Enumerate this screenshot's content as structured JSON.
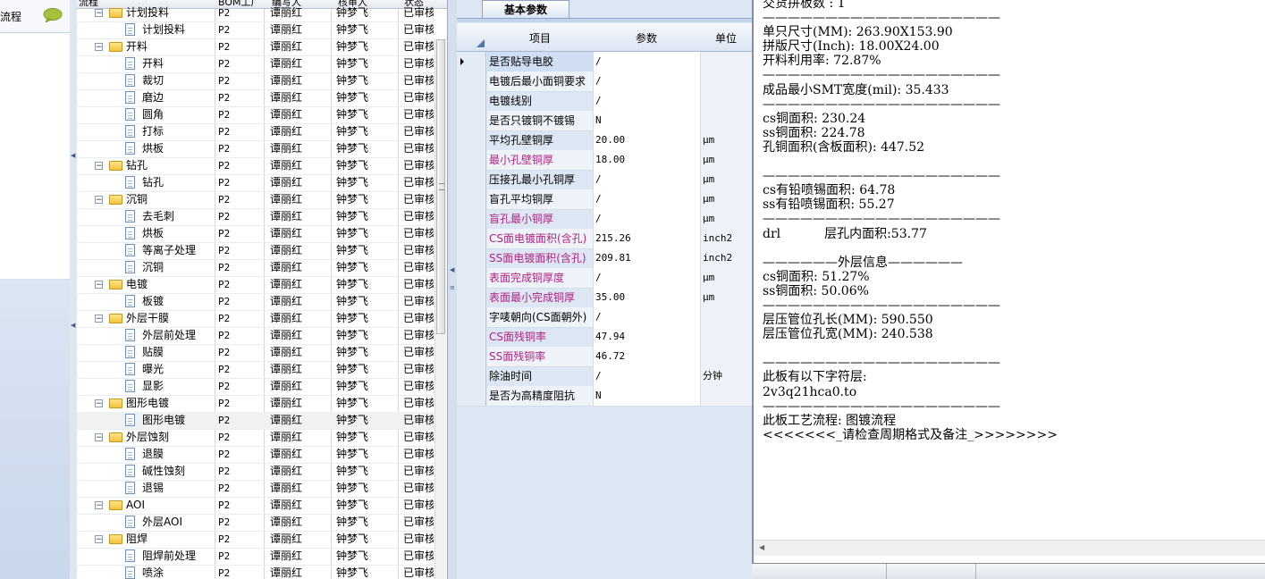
{
  "left_panel": {
    "label": "流程",
    "chat_icon": "chat-bubble-icon"
  },
  "tree": {
    "headers": {
      "flow": "流程",
      "bom": "BOM工厂",
      "author": "编写人",
      "reviewer": "核审人",
      "status": "状态"
    },
    "rows": [
      {
        "name": "计划投料",
        "level": 0,
        "type": "folder",
        "bom": "P2",
        "author": "谭丽红",
        "reviewer": "钟梦飞",
        "status": "已审核"
      },
      {
        "name": "计划投料",
        "level": 1,
        "type": "doc",
        "bom": "P2",
        "author": "谭丽红",
        "reviewer": "钟梦飞",
        "status": "已审核"
      },
      {
        "name": "开料",
        "level": 0,
        "type": "folder",
        "bom": "P2",
        "author": "谭丽红",
        "reviewer": "钟梦飞",
        "status": "已审核"
      },
      {
        "name": "开料",
        "level": 1,
        "type": "doc",
        "bom": "P2",
        "author": "谭丽红",
        "reviewer": "钟梦飞",
        "status": "已审核"
      },
      {
        "name": "裁切",
        "level": 1,
        "type": "doc",
        "bom": "P2",
        "author": "谭丽红",
        "reviewer": "钟梦飞",
        "status": "已审核"
      },
      {
        "name": "磨边",
        "level": 1,
        "type": "doc",
        "bom": "P2",
        "author": "谭丽红",
        "reviewer": "钟梦飞",
        "status": "已审核"
      },
      {
        "name": "圆角",
        "level": 1,
        "type": "doc",
        "bom": "P2",
        "author": "谭丽红",
        "reviewer": "钟梦飞",
        "status": "已审核"
      },
      {
        "name": "打标",
        "level": 1,
        "type": "doc",
        "bom": "P2",
        "author": "谭丽红",
        "reviewer": "钟梦飞",
        "status": "已审核"
      },
      {
        "name": "烘板",
        "level": 1,
        "type": "doc",
        "bom": "P2",
        "author": "谭丽红",
        "reviewer": "钟梦飞",
        "status": "已审核"
      },
      {
        "name": "钻孔",
        "level": 0,
        "type": "folder",
        "bom": "P2",
        "author": "谭丽红",
        "reviewer": "钟梦飞",
        "status": "已审核"
      },
      {
        "name": "钻孔",
        "level": 1,
        "type": "doc",
        "bom": "P2",
        "author": "谭丽红",
        "reviewer": "钟梦飞",
        "status": "已审核"
      },
      {
        "name": "沉铜",
        "level": 0,
        "type": "folder",
        "bom": "P2",
        "author": "谭丽红",
        "reviewer": "钟梦飞",
        "status": "已审核"
      },
      {
        "name": "去毛刺",
        "level": 1,
        "type": "doc",
        "bom": "P2",
        "author": "谭丽红",
        "reviewer": "钟梦飞",
        "status": "已审核"
      },
      {
        "name": "烘板",
        "level": 1,
        "type": "doc",
        "bom": "P2",
        "author": "谭丽红",
        "reviewer": "钟梦飞",
        "status": "已审核"
      },
      {
        "name": "等离子处理",
        "level": 1,
        "type": "doc",
        "bom": "P2",
        "author": "谭丽红",
        "reviewer": "钟梦飞",
        "status": "已审核"
      },
      {
        "name": "沉铜",
        "level": 1,
        "type": "doc",
        "bom": "P2",
        "author": "谭丽红",
        "reviewer": "钟梦飞",
        "status": "已审核"
      },
      {
        "name": "电镀",
        "level": 0,
        "type": "folder",
        "bom": "P2",
        "author": "谭丽红",
        "reviewer": "钟梦飞",
        "status": "已审核"
      },
      {
        "name": "板镀",
        "level": 1,
        "type": "doc",
        "bom": "P2",
        "author": "谭丽红",
        "reviewer": "钟梦飞",
        "status": "已审核"
      },
      {
        "name": "外层干膜",
        "level": 0,
        "type": "folder",
        "bom": "P2",
        "author": "谭丽红",
        "reviewer": "钟梦飞",
        "status": "已审核"
      },
      {
        "name": "外层前处理",
        "level": 1,
        "type": "doc",
        "bom": "P2",
        "author": "谭丽红",
        "reviewer": "钟梦飞",
        "status": "已审核"
      },
      {
        "name": "贴膜",
        "level": 1,
        "type": "doc",
        "bom": "P2",
        "author": "谭丽红",
        "reviewer": "钟梦飞",
        "status": "已审核"
      },
      {
        "name": "曝光",
        "level": 1,
        "type": "doc",
        "bom": "P2",
        "author": "谭丽红",
        "reviewer": "钟梦飞",
        "status": "已审核"
      },
      {
        "name": "显影",
        "level": 1,
        "type": "doc",
        "bom": "P2",
        "author": "谭丽红",
        "reviewer": "钟梦飞",
        "status": "已审核"
      },
      {
        "name": "图形电镀",
        "level": 0,
        "type": "folder",
        "bom": "P2",
        "author": "谭丽红",
        "reviewer": "钟梦飞",
        "status": "已审核"
      },
      {
        "name": "图形电镀",
        "level": 1,
        "type": "doc",
        "bom": "P2",
        "author": "谭丽红",
        "reviewer": "钟梦飞",
        "status": "已审核",
        "selected": true
      },
      {
        "name": "外层蚀刻",
        "level": 0,
        "type": "folder",
        "bom": "P2",
        "author": "谭丽红",
        "reviewer": "钟梦飞",
        "status": "已审核"
      },
      {
        "name": "退膜",
        "level": 1,
        "type": "doc",
        "bom": "P2",
        "author": "谭丽红",
        "reviewer": "钟梦飞",
        "status": "已审核"
      },
      {
        "name": "碱性蚀刻",
        "level": 1,
        "type": "doc",
        "bom": "P2",
        "author": "谭丽红",
        "reviewer": "钟梦飞",
        "status": "已审核"
      },
      {
        "name": "退锡",
        "level": 1,
        "type": "doc",
        "bom": "P2",
        "author": "谭丽红",
        "reviewer": "钟梦飞",
        "status": "已审核"
      },
      {
        "name": "AOI",
        "level": 0,
        "type": "folder",
        "bom": "P2",
        "author": "谭丽红",
        "reviewer": "钟梦飞",
        "status": "已审核"
      },
      {
        "name": "外层AOI",
        "level": 1,
        "type": "doc",
        "bom": "P2",
        "author": "谭丽红",
        "reviewer": "钟梦飞",
        "status": "已审核"
      },
      {
        "name": "阻焊",
        "level": 0,
        "type": "folder",
        "bom": "P2",
        "author": "谭丽红",
        "reviewer": "钟梦飞",
        "status": "已审核"
      },
      {
        "name": "阻焊前处理",
        "level": 1,
        "type": "doc",
        "bom": "P2",
        "author": "谭丽红",
        "reviewer": "钟梦飞",
        "status": "已审核"
      },
      {
        "name": "喷涂",
        "level": 1,
        "type": "doc",
        "bom": "P2",
        "author": "谭丽红",
        "reviewer": "钟梦飞",
        "status": "已审核"
      }
    ]
  },
  "params": {
    "tab_label": "基本参数",
    "headers": {
      "item": "项目",
      "param": "参数",
      "unit": "单位"
    },
    "rows": [
      {
        "item": "是否贴导电胶",
        "value": "/",
        "unit": "",
        "pink": false,
        "current": true
      },
      {
        "item": "电镀后最小面铜要求",
        "value": "/",
        "unit": "",
        "pink": false
      },
      {
        "item": "电镀线别",
        "value": "/",
        "unit": "",
        "pink": false
      },
      {
        "item": "是否只镀铜不镀锡",
        "value": "N",
        "unit": "",
        "pink": false
      },
      {
        "item": "平均孔壁铜厚",
        "value": "20.00",
        "unit": "μm",
        "pink": false
      },
      {
        "item": "最小孔壁铜厚",
        "value": "18.00",
        "unit": "μm",
        "pink": true
      },
      {
        "item": "压接孔最小孔铜厚",
        "value": "/",
        "unit": "μm",
        "pink": false
      },
      {
        "item": "盲孔平均铜厚",
        "value": "/",
        "unit": "μm",
        "pink": false
      },
      {
        "item": "盲孔最小铜厚",
        "value": "/",
        "unit": "μm",
        "pink": true
      },
      {
        "item": "CS面电镀面积(含孔)",
        "value": "215.26",
        "unit": "inch2",
        "pink": true
      },
      {
        "item": "SS面电镀面积(含孔)",
        "value": "209.81",
        "unit": "inch2",
        "pink": true
      },
      {
        "item": "表面完成铜厚度",
        "value": "/",
        "unit": "μm",
        "pink": true
      },
      {
        "item": "表面最小完成铜厚",
        "value": "35.00",
        "unit": "μm",
        "pink": true
      },
      {
        "item": "字唛朝向(CS面朝外)",
        "value": "/",
        "unit": "",
        "pink": false
      },
      {
        "item": "CS面残铜率",
        "value": "47.94",
        "unit": "",
        "pink": true
      },
      {
        "item": "SS面残铜率",
        "value": "46.72",
        "unit": "",
        "pink": true
      },
      {
        "item": "除油时间",
        "value": "/",
        "unit": "分钟",
        "pink": false
      },
      {
        "item": "是否为高精度阻抗",
        "value": "N",
        "unit": "",
        "pink": false
      }
    ]
  },
  "output": {
    "lines": [
      "交货拼板数 : 1",
      "———————————————————",
      "单只尺寸(MM): 263.90X153.90",
      "拼版尺寸(Inch): 18.00X24.00",
      "开料利用率: 72.87%",
      "———————————————————",
      "成品最小SMT宽度(mil): 35.433",
      "———————————————————",
      "cs铜面积: 230.24",
      "ss铜面积: 224.78",
      "孔铜面积(含板面积): 447.52",
      "",
      "———————————————————",
      "cs有铅喷锡面积: 64.78",
      "ss有铅喷锡面积: 55.27",
      "———————————————————",
      "drl           层孔内面积:53.77",
      "",
      "——————外层信息——————",
      "cs铜面积: 51.27%",
      "ss铜面积: 50.06%",
      "———————————————————",
      "层压管位孔长(MM): 590.550",
      "层压管位孔宽(MM): 240.538",
      "",
      "———————————————————",
      "此板有以下字符层:",
      "2v3q21hca0.to",
      "———————————————————",
      "此板工艺流程: 图镀流程",
      "<<<<<<<_请检查周期格式及备注_>>>>>>>>"
    ]
  }
}
